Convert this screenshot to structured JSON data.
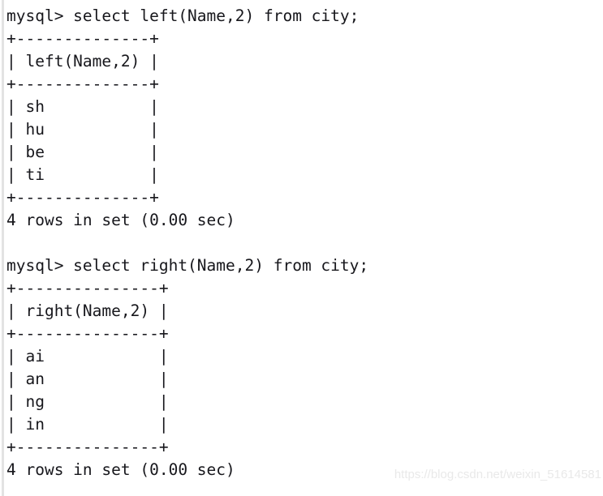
{
  "terminal": {
    "prompt": "mysql>",
    "blocks": [
      {
        "name": "left-query-block",
        "command": "mysql> select left(Name,2) from city;",
        "table_top_border": "+--------------+",
        "table_header_row": "| left(Name,2) |",
        "table_header_separator": "+--------------+",
        "table_rows": [
          "| sh           |",
          "| hu           |",
          "| be           |",
          "| ti           |"
        ],
        "table_bottom_border": "+--------------+",
        "result_status": "4 rows in set (0.00 sec)"
      },
      {
        "name": "right-query-block",
        "command": "mysql> select right(Name,2) from city;",
        "table_top_border": "+---------------+",
        "table_header_row": "| right(Name,2) |",
        "table_header_separator": "+---------------+",
        "table_rows": [
          "| ai            |",
          "| an            |",
          "| ng            |",
          "| in            |"
        ],
        "table_bottom_border": "+---------------+",
        "result_status": "4 rows in set (0.00 sec)"
      }
    ],
    "blank_line": " "
  },
  "watermark": {
    "text": "https://blog.csdn.net/weixin_51614581"
  },
  "colors": {
    "background": "#ffffff",
    "text": "#17171c",
    "gutter_rule": "#e3e3e3",
    "watermark": "#e9e9e9"
  }
}
